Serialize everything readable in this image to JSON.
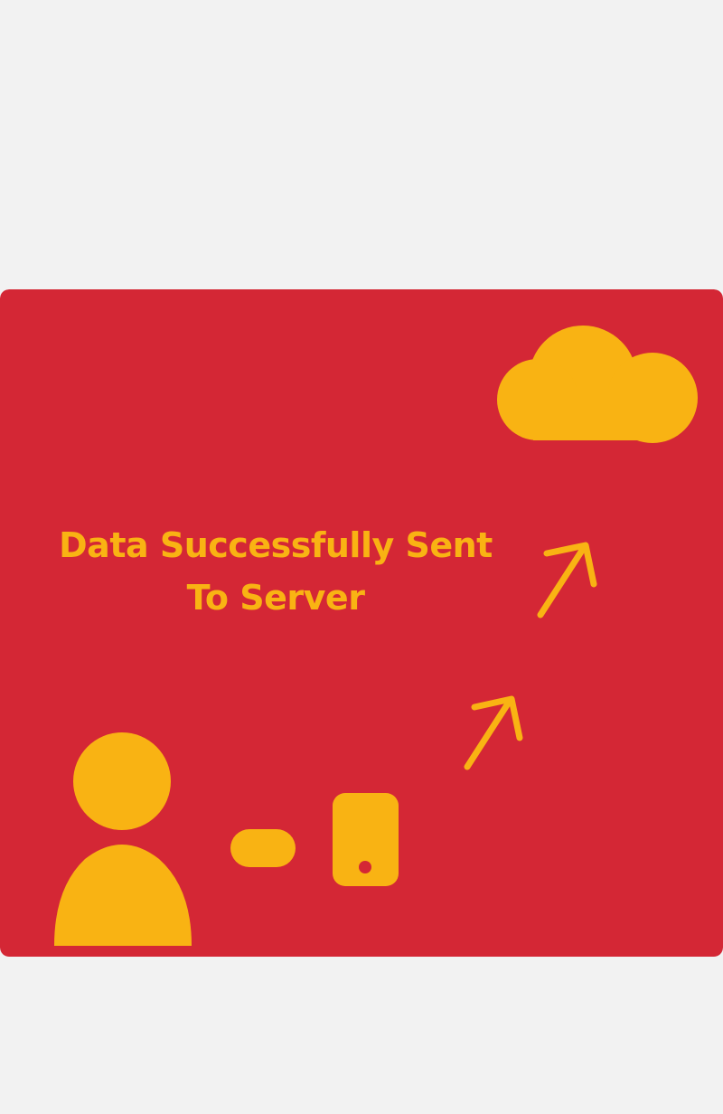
{
  "message": {
    "line1": "Data Successfully Sent",
    "line2": "To Server"
  },
  "colors": {
    "page_background": "#f2f2f2",
    "panel_background": "#d42735",
    "accent": "#f9b313"
  },
  "icons": {
    "user": "user-icon",
    "connector": "connector-icon",
    "device": "smartphone-icon",
    "arrow": "arrow-up-right-icon",
    "server": "cloud-icon"
  }
}
